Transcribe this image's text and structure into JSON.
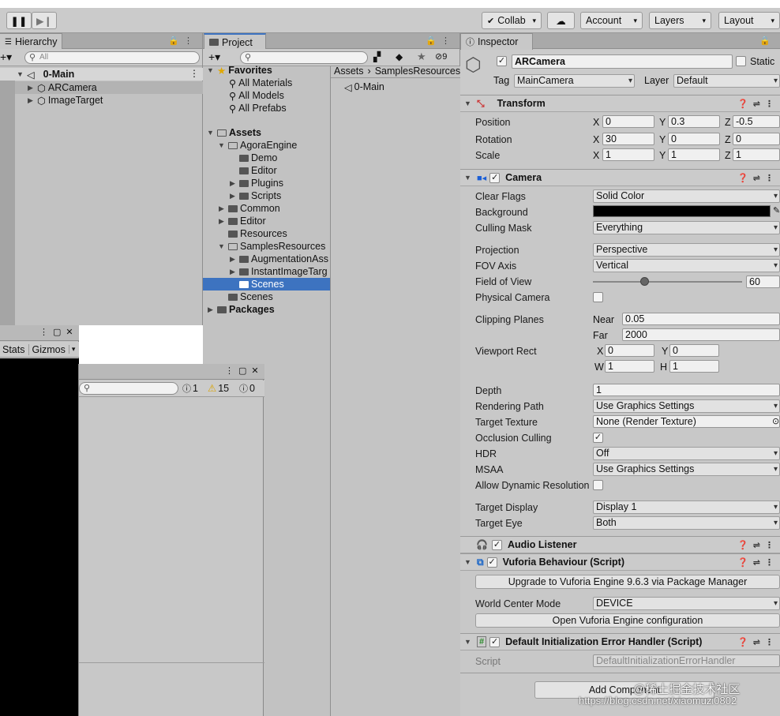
{
  "toolbar": {
    "collab_label": "Collab",
    "account_label": "Account",
    "layers_label": "Layers",
    "layout_label": "Layout"
  },
  "hierarchy": {
    "tab_label": "Hierarchy",
    "search_placeholder": "All",
    "scene": "0-Main",
    "items": [
      "ARCamera",
      "ImageTarget"
    ]
  },
  "project": {
    "tab_label": "Project",
    "hidden_count": "9",
    "favorites": {
      "label": "Favorites",
      "items": [
        "All Materials",
        "All Models",
        "All Prefabs"
      ]
    },
    "assets_label": "Assets",
    "tree": [
      "AgoraEngine",
      "Demo",
      "Editor",
      "Plugins",
      "Scripts",
      "Common",
      "Editor",
      "Resources",
      "SamplesResources",
      "AugmentationAss",
      "InstantImageTarg",
      "Scenes",
      "Scenes"
    ],
    "packages_label": "Packages",
    "breadcrumb": [
      "Assets",
      "SamplesResources"
    ],
    "file": "0-Main"
  },
  "scene_view": {
    "stats_label": "Stats",
    "gizmos_label": "Gizmos"
  },
  "console": {
    "info_count": "1",
    "warn_count": "15",
    "error_count": "0"
  },
  "inspector": {
    "tab_label": "Inspector",
    "object_name": "ARCamera",
    "static_label": "Static",
    "tag_label": "Tag",
    "tag_value": "MainCamera",
    "layer_label": "Layer",
    "layer_value": "Default",
    "transform": {
      "title": "Transform",
      "position_label": "Position",
      "rotation_label": "Rotation",
      "scale_label": "Scale",
      "position": [
        "0",
        "0.3",
        "-0.5"
      ],
      "rotation": [
        "30",
        "0",
        "0"
      ],
      "scale": [
        "1",
        "1",
        "1"
      ],
      "axis_x": "X",
      "axis_y": "Y",
      "axis_z": "Z"
    },
    "camera": {
      "title": "Camera",
      "clear_flags_label": "Clear Flags",
      "clear_flags": "Solid Color",
      "background_label": "Background",
      "background_color": "#000000",
      "culling_mask_label": "Culling Mask",
      "culling_mask": "Everything",
      "projection_label": "Projection",
      "projection": "Perspective",
      "fov_axis_label": "FOV Axis",
      "fov_axis": "Vertical",
      "fov_label": "Field of View",
      "fov_value": "60",
      "fov_slider_fraction": 0.35,
      "physical_camera_label": "Physical Camera",
      "clipping_label": "Clipping Planes",
      "near_label": "Near",
      "near_value": "0.05",
      "far_label": "Far",
      "far_value": "2000",
      "viewport_label": "Viewport Rect",
      "vp_x_label": "X",
      "vp_y_label": "Y",
      "vp_w_label": "W",
      "vp_h_label": "H",
      "vp_x": "0",
      "vp_y": "0",
      "vp_w": "1",
      "vp_h": "1",
      "depth_label": "Depth",
      "depth": "1",
      "rendering_path_label": "Rendering Path",
      "rendering_path": "Use Graphics Settings",
      "target_texture_label": "Target Texture",
      "target_texture": "None (Render Texture)",
      "occlusion_label": "Occlusion Culling",
      "hdr_label": "HDR",
      "hdr": "Off",
      "msaa_label": "MSAA",
      "msaa": "Use Graphics Settings",
      "dynamic_res_label": "Allow Dynamic Resolution",
      "target_display_label": "Target Display",
      "target_display": "Display 1",
      "target_eye_label": "Target Eye",
      "target_eye": "Both"
    },
    "audio_listener_title": "Audio Listener",
    "vuforia": {
      "title": "Vuforia Behaviour (Script)",
      "upgrade_button": "Upgrade to Vuforia Engine 9.6.3 via Package Manager",
      "world_center_label": "World Center Mode",
      "world_center": "DEVICE",
      "config_button": "Open Vuforia Engine configuration"
    },
    "error_handler": {
      "title": "Default Initialization Error Handler (Script)",
      "script_label": "Script",
      "script_value": "DefaultInitializationErrorHandler"
    },
    "add_component": "Add Component"
  },
  "watermark": {
    "line1": "@稀土掘金技术社区",
    "line2": "https://blog.csdn.net/xiaomuzi0802"
  }
}
